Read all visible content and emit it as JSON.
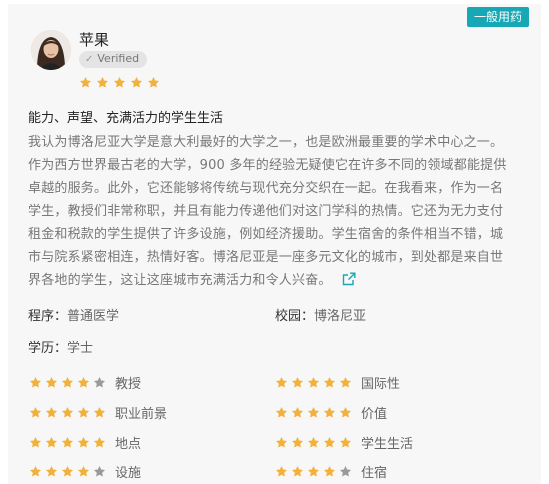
{
  "badge": "一般用药",
  "reviewer": {
    "name": "苹果",
    "verified": "Verified",
    "rating": 5
  },
  "review": {
    "title": "能力、声望、充满活力的学生生活",
    "body": "我认为博洛尼亚大学是意大利最好的大学之一，也是欧洲最重要的学术中心之一。作为西方世界最古老的大学，900 多年的经验无疑使它在许多不同的领域都能提供卓越的服务。此外，它还能够将传统与现代充分交织在一起。在我看来，作为一名学生，教授们非常称职，并且有能力传递他们对这门学科的热情。它还为无力支付租金和税款的学生提供了许多设施，例如经济援助。学生宿舍的条件相当不错，城市与院系紧密相连，热情好客。博洛尼亚是一座多元文化的城市，到处都是来自世界各地的学生，这让这座城市充满活力和令人兴奋。"
  },
  "fields": {
    "program_label": "程序：",
    "program": "普通医学",
    "campus_label": "校园：",
    "campus": "博洛尼亚",
    "degree_label": "学历：",
    "degree": "学士"
  },
  "ratings": [
    {
      "label": "教授",
      "stars": 4
    },
    {
      "label": "国际性",
      "stars": 5
    },
    {
      "label": "职业前景",
      "stars": 5
    },
    {
      "label": "价值",
      "stars": 5
    },
    {
      "label": "地点",
      "stars": 5
    },
    {
      "label": "学生生活",
      "stars": 5
    },
    {
      "label": "设施",
      "stars": 4
    },
    {
      "label": "住宿",
      "stars": 4
    }
  ],
  "colors": {
    "star_on": "#f2b13b",
    "star_off": "#9a9a9a",
    "badge": "#17a7b5",
    "link": "#17a7b5"
  }
}
